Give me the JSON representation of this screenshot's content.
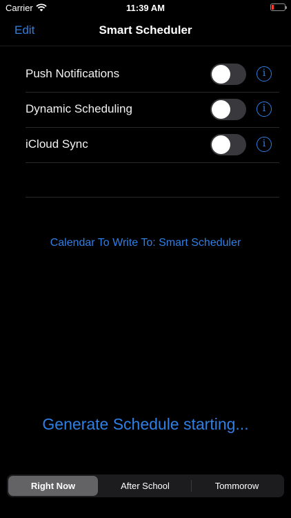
{
  "status_bar": {
    "carrier": "Carrier",
    "time": "11:39 AM",
    "battery_level": 0.1
  },
  "nav": {
    "edit_label": "Edit",
    "title": "Smart Scheduler"
  },
  "settings": [
    {
      "label": "Push Notifications",
      "enabled": false
    },
    {
      "label": "Dynamic Scheduling",
      "enabled": false
    },
    {
      "label": "iCloud Sync",
      "enabled": false
    }
  ],
  "info_glyph": "i",
  "calendar_link": "Calendar To Write To: Smart Scheduler",
  "generate_button": "Generate Schedule starting...",
  "segments": {
    "selected_index": 0,
    "items": [
      "Right Now",
      "After School",
      "Tommorow"
    ]
  },
  "colors": {
    "accent": "#2f7fe5",
    "background": "#000000",
    "toggle_off": "#39393d",
    "segment_selected": "#636366",
    "battery_low": "#ff3b30"
  }
}
